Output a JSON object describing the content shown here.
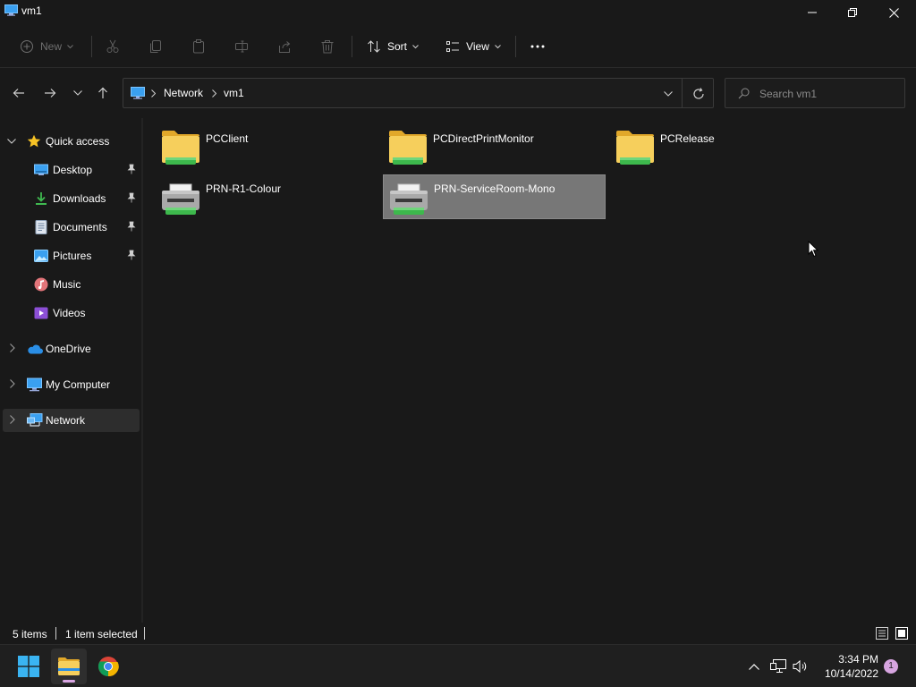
{
  "window": {
    "title": "vm1"
  },
  "toolbar": {
    "new_label": "New",
    "sort_label": "Sort",
    "view_label": "View"
  },
  "address": {
    "crumbs": [
      "Network",
      "vm1"
    ]
  },
  "search": {
    "placeholder": "Search vm1"
  },
  "nav": {
    "quick_access": "Quick access",
    "items": [
      {
        "label": "Desktop",
        "icon": "desktop-icon",
        "pinned": true
      },
      {
        "label": "Downloads",
        "icon": "downloads-icon",
        "pinned": true
      },
      {
        "label": "Documents",
        "icon": "documents-icon",
        "pinned": true
      },
      {
        "label": "Pictures",
        "icon": "pictures-icon",
        "pinned": true
      },
      {
        "label": "Music",
        "icon": "music-icon",
        "pinned": false
      },
      {
        "label": "Videos",
        "icon": "videos-icon",
        "pinned": false
      }
    ],
    "onedrive": "OneDrive",
    "my_computer": "My Computer",
    "network": "Network"
  },
  "content": {
    "items": [
      {
        "name": "PCClient",
        "type": "shared-folder",
        "selected": false
      },
      {
        "name": "PCDirectPrintMonitor",
        "type": "shared-folder",
        "selected": false
      },
      {
        "name": "PCRelease",
        "type": "shared-folder",
        "selected": false
      },
      {
        "name": "PRN-R1-Colour",
        "type": "shared-printer",
        "selected": false
      },
      {
        "name": "PRN-ServiceRoom-Mono",
        "type": "shared-printer",
        "selected": true
      }
    ]
  },
  "status": {
    "item_count": "5 items",
    "selection": "1 item selected"
  },
  "taskbar": {
    "time": "3:34 PM",
    "date": "10/14/2022",
    "notifications": "1"
  },
  "colors": {
    "background": "#191919",
    "selection": "#777777",
    "folder": "#f3c54b",
    "share_green": "#3db84c",
    "accent_blue": "#3aa0f0"
  }
}
